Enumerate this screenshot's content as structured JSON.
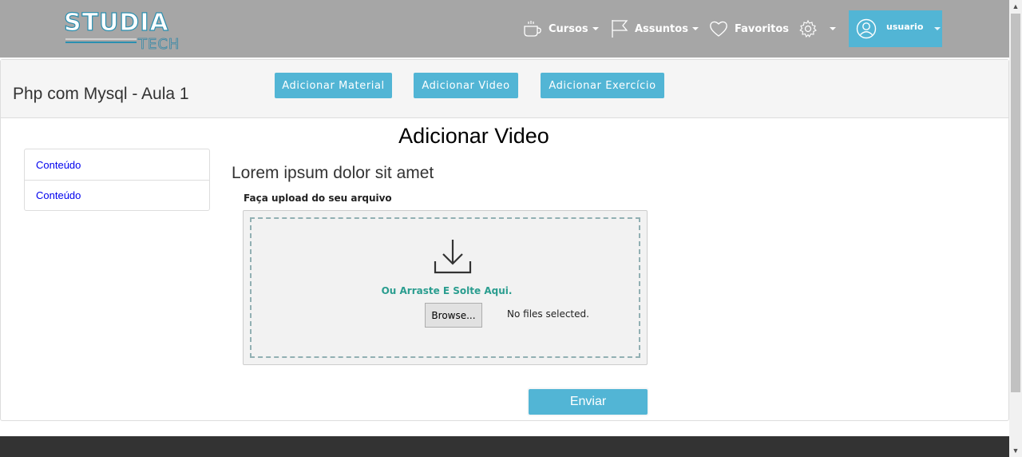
{
  "navbar": {
    "logo_text": "STUDIA",
    "logo_subtext": "TECH",
    "cursos_label": "Cursos",
    "assuntos_label": "Assuntos",
    "favoritos_label": "Favoritos",
    "user_label": "usuario"
  },
  "header": {
    "title": "Php com Mysql - Aula 1",
    "buttons": [
      {
        "label": "Adicionar Material"
      },
      {
        "label": "Adicionar Video"
      },
      {
        "label": "Adicionar Exercício"
      }
    ]
  },
  "main": {
    "section_title": "Adicionar Video",
    "subtitle": "Lorem ipsum dolor sit amet",
    "upload_label": "Faça upload do seu arquivo",
    "drop_text": "Ou Arraste E Solte Aqui.",
    "browse_label": "Browse...",
    "file_status": "No files selected.",
    "submit_label": "Enviar"
  },
  "sidebar": {
    "items": [
      {
        "label": "Conteúdo"
      },
      {
        "label": "Conteúdo"
      }
    ]
  },
  "colors": {
    "navbar_bg": "#a6a6a6",
    "accent": "#52b5d5",
    "drop_text": "#2a9d8f",
    "footer_bg": "#333333"
  },
  "icons": {
    "cursos": "coffee-cup-icon",
    "assuntos": "flag-icon",
    "favoritos": "heart-icon",
    "settings": "gear-icon",
    "user": "user-circle-icon",
    "upload": "download-arrow-icon"
  }
}
